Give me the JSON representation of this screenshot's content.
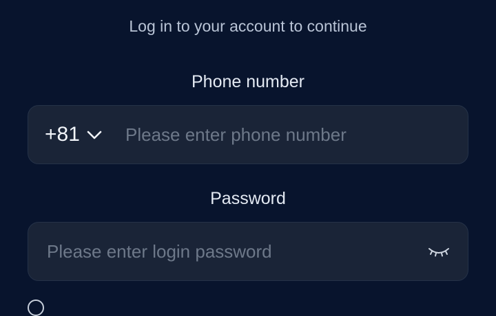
{
  "header": {
    "subtitle": "Log in to your account to continue"
  },
  "phone": {
    "label": "Phone number",
    "country_code": "+81",
    "placeholder": "Please enter phone number"
  },
  "password": {
    "label": "Password",
    "placeholder": "Please enter login password"
  },
  "icons": {
    "country_dropdown": "chevron-down-icon",
    "password_toggle": "eye-closed-icon"
  },
  "colors": {
    "background": "#08142d",
    "field_background": "#1a2437",
    "text": "#e3e9f2",
    "muted_text": "#b9c4d6",
    "placeholder": "#6d7889"
  }
}
